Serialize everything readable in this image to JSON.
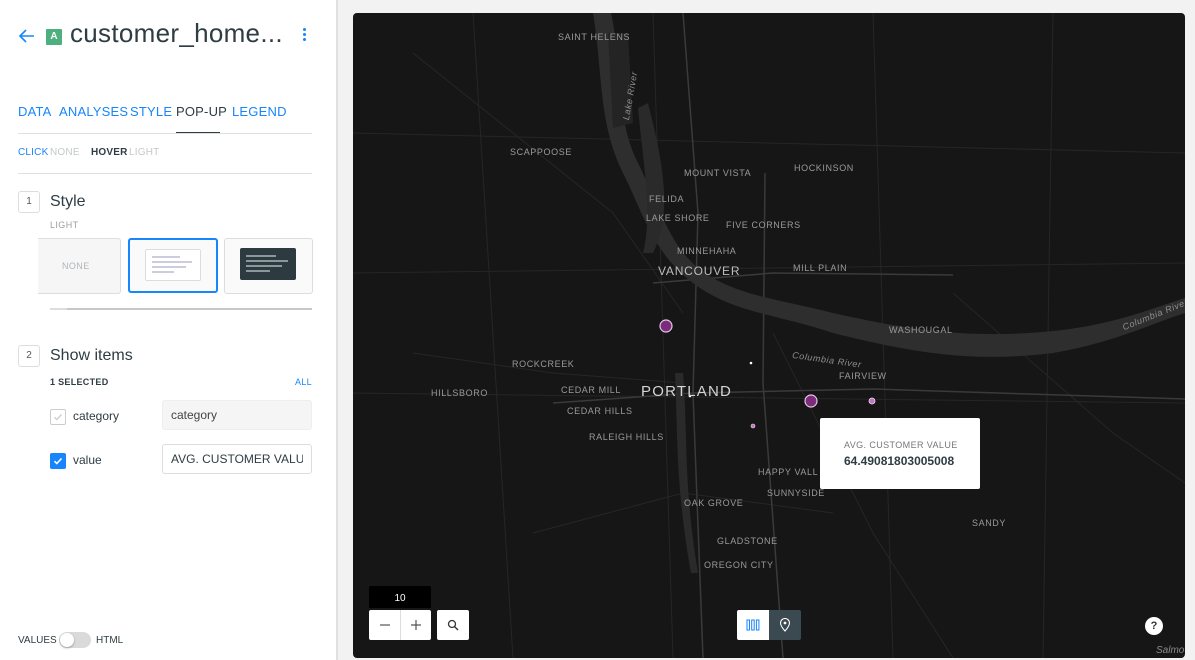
{
  "header": {
    "title": "customer_home...",
    "layer_letter": "A"
  },
  "tabs": [
    {
      "label": "DATA"
    },
    {
      "label": "ANALYSES"
    },
    {
      "label": "STYLE"
    },
    {
      "label": "POP-UP"
    },
    {
      "label": "LEGEND"
    }
  ],
  "subtabs": {
    "click_label": "CLICK",
    "click_value": "NONE",
    "hover_label": "HOVER",
    "hover_value": "LIGHT"
  },
  "style_section": {
    "number": "1",
    "title": "Style",
    "current": "LIGHT",
    "options": [
      {
        "label": "NONE"
      },
      {
        "label": "light",
        "selected": true
      },
      {
        "label": "dark"
      }
    ]
  },
  "items_section": {
    "number": "2",
    "title": "Show items",
    "selected_count": "1 SELECTED",
    "all_label": "ALL",
    "fields": [
      {
        "name": "category",
        "checked": false,
        "value": "category"
      },
      {
        "name": "value",
        "checked": true,
        "value": "AVG. CUSTOMER VALUE"
      }
    ]
  },
  "footer": {
    "values_label": "VALUES",
    "html_label": "HTML",
    "html_enabled": false
  },
  "map": {
    "places": {
      "saint_helens": "SAINT HELENS",
      "scappoose": "SCAPPOOSE",
      "lake_river": "Lake River",
      "felida": "FELIDA",
      "mount_vista": "MOUNT VISTA",
      "hockinson": "HOCKINSON",
      "lake_shore": "LAKE SHORE",
      "five_corners": "FIVE CORNERS",
      "minnehaha": "MINNEHAHA",
      "vancouver": "VANCOUVER",
      "mill_plain": "MILL PLAIN",
      "washougal": "WASHOUGAL",
      "columbia_river_1": "Columbia River",
      "columbia_river_2": "Columbia River",
      "rockcreek": "ROCKCREEK",
      "hillsboro": "HILLSBORO",
      "cedar_mill": "CEDAR MILL",
      "portland": "PORTLAND",
      "fairview": "FAIRVIEW",
      "cedar_hills": "CEDAR HILLS",
      "raleigh_hills": "RALEIGH HILLS",
      "happy_valley": "HAPPY VALL",
      "sunnyside": "SUNNYSIDE",
      "oak_grove": "OAK GROVE",
      "sandy": "SANDY",
      "gladstone": "GLADSTONE",
      "oregon_city": "OREGON CITY"
    },
    "tooltip": {
      "label": "AVG. CUSTOMER VALUE",
      "value": "64.49081803005008"
    },
    "zoom_level": "10",
    "help": "?",
    "attribution": "Salmo",
    "colors": {
      "background": "#161616",
      "point": "#7b2d7b",
      "accent": "#1785fb"
    }
  }
}
